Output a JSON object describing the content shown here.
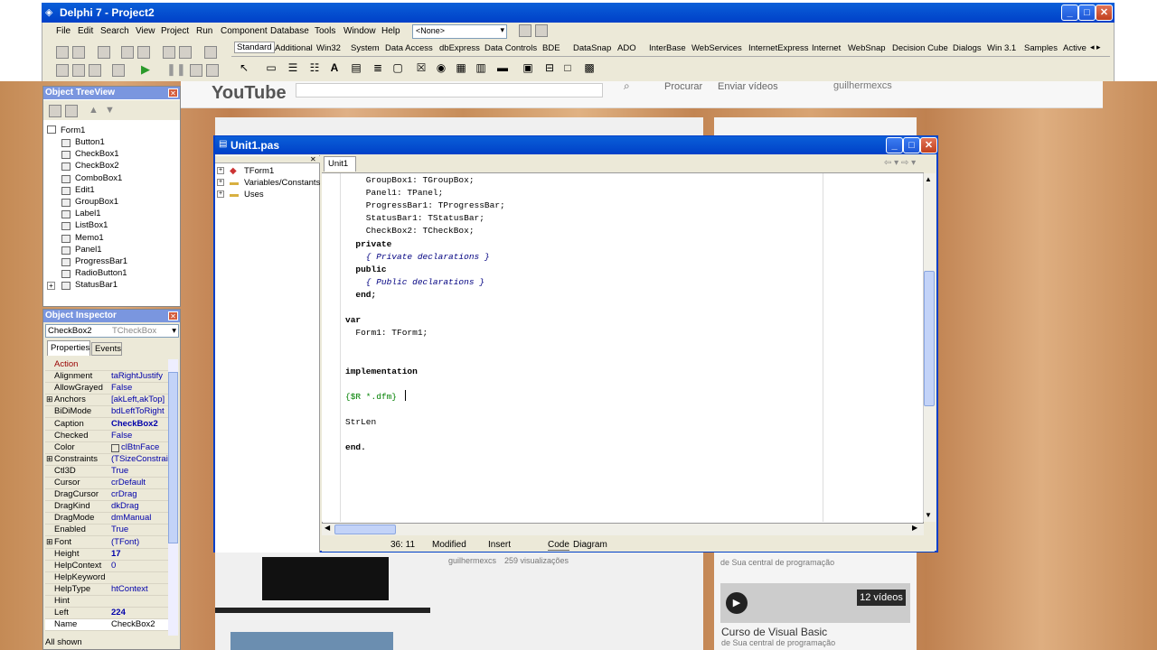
{
  "ide": {
    "title": "Delphi 7 - Project2",
    "menu": [
      "File",
      "Edit",
      "Search",
      "View",
      "Project",
      "Run",
      "Component",
      "Database",
      "Tools",
      "Window",
      "Help"
    ],
    "combo_value": "<None>",
    "palette_tabs": [
      "Standard",
      "Additional",
      "Win32",
      "System",
      "Data Access",
      "dbExpress",
      "Data Controls",
      "BDE",
      "DataSnap",
      "ADO",
      "InterBase",
      "WebServices",
      "InternetExpress",
      "Internet",
      "WebSnap",
      "Decision Cube",
      "Dialogs",
      "Win 3.1",
      "Samples",
      "Active"
    ]
  },
  "treeview": {
    "title": "Object TreeView",
    "root": "Form1",
    "items": [
      "Button1",
      "CheckBox1",
      "CheckBox2",
      "ComboBox1",
      "Edit1",
      "GroupBox1",
      "Label1",
      "ListBox1",
      "Memo1",
      "Panel1",
      "ProgressBar1",
      "RadioButton1",
      "StatusBar1"
    ]
  },
  "inspector": {
    "title": "Object Inspector",
    "object_name": "CheckBox2",
    "object_type": "TCheckBox",
    "tabs": [
      "Properties",
      "Events"
    ],
    "props": [
      {
        "n": "Action",
        "v": ""
      },
      {
        "n": "Alignment",
        "v": "taRightJustify"
      },
      {
        "n": "AllowGrayed",
        "v": "False"
      },
      {
        "n": "Anchors",
        "v": "[akLeft,akTop]"
      },
      {
        "n": "BiDiMode",
        "v": "bdLeftToRight"
      },
      {
        "n": "Caption",
        "v": "CheckBox2"
      },
      {
        "n": "Checked",
        "v": "False"
      },
      {
        "n": "Color",
        "v": "clBtnFace"
      },
      {
        "n": "Constraints",
        "v": "(TSizeConstrain"
      },
      {
        "n": "Ctl3D",
        "v": "True"
      },
      {
        "n": "Cursor",
        "v": "crDefault"
      },
      {
        "n": "DragCursor",
        "v": "crDrag"
      },
      {
        "n": "DragKind",
        "v": "dkDrag"
      },
      {
        "n": "DragMode",
        "v": "dmManual"
      },
      {
        "n": "Enabled",
        "v": "True"
      },
      {
        "n": "Font",
        "v": "(TFont)"
      },
      {
        "n": "Height",
        "v": "17"
      },
      {
        "n": "HelpContext",
        "v": "0"
      },
      {
        "n": "HelpKeyword",
        "v": ""
      },
      {
        "n": "HelpType",
        "v": "htContext"
      },
      {
        "n": "Hint",
        "v": ""
      },
      {
        "n": "Left",
        "v": "224"
      },
      {
        "n": "Name",
        "v": "CheckBox2"
      }
    ],
    "status": "All shown"
  },
  "unit": {
    "title": "Unit1.pas",
    "tab": "Unit1",
    "tree": [
      "TForm1",
      "Variables/Constants",
      "Uses"
    ],
    "code": [
      {
        "t": "    GroupBox1: TGroupBox;",
        "c": ""
      },
      {
        "t": "    Panel1: TPanel;",
        "c": ""
      },
      {
        "t": "    ProgressBar1: TProgressBar;",
        "c": ""
      },
      {
        "t": "    StatusBar1: TStatusBar;",
        "c": ""
      },
      {
        "t": "    CheckBox2: TCheckBox;",
        "c": ""
      },
      {
        "t": "  private",
        "c": "kw"
      },
      {
        "t": "    { Private declarations }",
        "c": "cm"
      },
      {
        "t": "  public",
        "c": "kw"
      },
      {
        "t": "    { Public declarations }",
        "c": "cm"
      },
      {
        "t": "  end;",
        "c": "kw"
      },
      {
        "t": "",
        "c": ""
      },
      {
        "t": "var",
        "c": "kw"
      },
      {
        "t": "  Form1: TForm1;",
        "c": ""
      },
      {
        "t": "",
        "c": ""
      },
      {
        "t": "",
        "c": ""
      },
      {
        "t": "implementation",
        "c": "kw"
      },
      {
        "t": "",
        "c": ""
      },
      {
        "t": "{$R *.dfm}",
        "c": "dir"
      },
      {
        "t": "",
        "c": ""
      },
      {
        "t": "StrLen",
        "c": ""
      },
      {
        "t": "",
        "c": ""
      },
      {
        "t": "end.",
        "c": "kw"
      }
    ],
    "status": {
      "pos": "36: 11",
      "modified": "Modified",
      "insert": "Insert",
      "code_tab": "Code",
      "diagram_tab": "Diagram"
    }
  },
  "youtube": {
    "logo": "YouTube",
    "procurar": "Procurar",
    "enviar": "Enviar vídeos",
    "user": "guilhermexcs",
    "meta_user": "guilhermexcs",
    "meta_views": "259 visualizações",
    "side_text": "de Sua central de programação",
    "count": "12 vídeos",
    "curso": "Curso de Visual Basic",
    "side_text2": "de Sua central de programação"
  }
}
